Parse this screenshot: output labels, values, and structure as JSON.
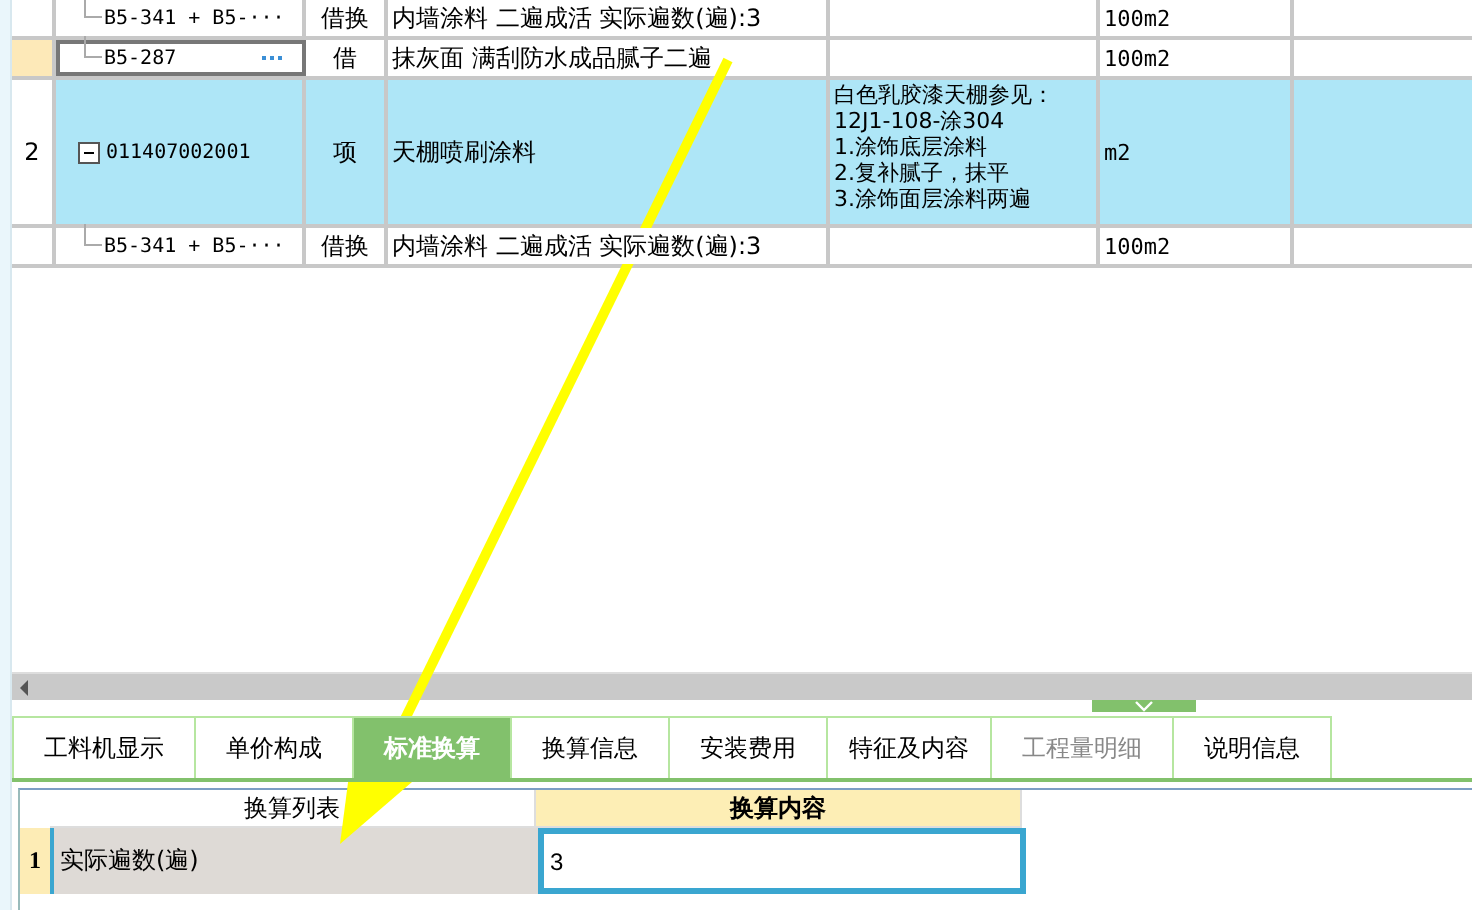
{
  "table": {
    "rows": [
      {
        "kind": "sub",
        "number": "",
        "code": "B5-341 + B5-···",
        "type": "借换",
        "name": "内墙涂料 二遍成活  实际遍数(遍):3",
        "features": "",
        "unit": "100m2",
        "selected": false,
        "has_picker": false
      },
      {
        "kind": "sub",
        "number": "",
        "code": "B5-287",
        "type": "借",
        "name": "抹灰面 满刮防水成品腻子二遍",
        "features": "",
        "unit": "100m2",
        "selected": true,
        "has_picker": true
      },
      {
        "kind": "item",
        "number": "2",
        "code": "011407002001",
        "type": "项",
        "name": "天棚喷刷涂料",
        "features": "白色乳胶漆天棚参见：\n12J1-108-涂304\n1.涂饰底层涂料\n2.复补腻子，抹平\n3.涂饰面层涂料两遍",
        "unit": "m2",
        "selected": false,
        "has_picker": false,
        "expanded": true
      },
      {
        "kind": "sub",
        "number": "",
        "code": "B5-341 + B5-···",
        "type": "借换",
        "name": "内墙涂料 二遍成活  实际遍数(遍):3",
        "features": "",
        "unit": "100m2",
        "selected": false,
        "has_picker": false
      }
    ]
  },
  "tabs": [
    {
      "label": "工料机显示",
      "selected": false,
      "disabled": false
    },
    {
      "label": "单价构成",
      "selected": false,
      "disabled": false
    },
    {
      "label": "标准换算",
      "selected": true,
      "disabled": false
    },
    {
      "label": "换算信息",
      "selected": false,
      "disabled": false
    },
    {
      "label": "安装费用",
      "selected": false,
      "disabled": false
    },
    {
      "label": "特征及内容",
      "selected": false,
      "disabled": false
    },
    {
      "label": "工程量明细",
      "selected": false,
      "disabled": true
    },
    {
      "label": "说明信息",
      "selected": false,
      "disabled": false
    }
  ],
  "conversion": {
    "columns": [
      {
        "label": "换算列表",
        "selected": false
      },
      {
        "label": "换算内容",
        "selected": true
      }
    ],
    "rows": [
      {
        "number": "1",
        "name": "实际遍数(遍)",
        "value": "3",
        "selected": true
      }
    ]
  }
}
